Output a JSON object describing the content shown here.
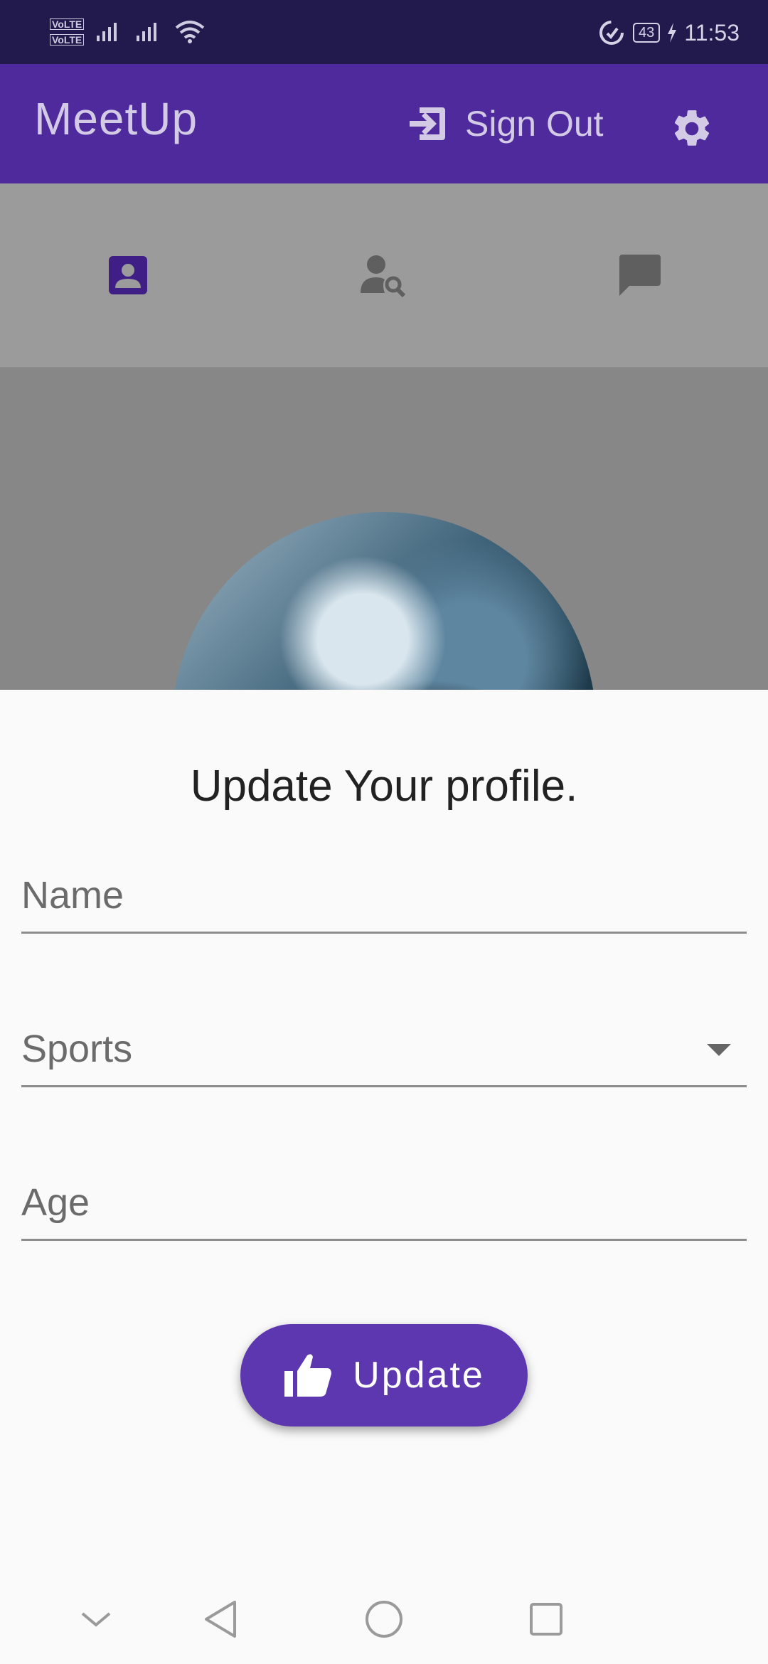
{
  "status_bar": {
    "volte_1": "VoLTE",
    "volte_2": "VoLTE",
    "battery": "43",
    "time": "11:53",
    "icons": [
      "signal-icon",
      "signal-icon",
      "wifi-icon",
      "data-saver-icon",
      "battery-icon",
      "charging-icon"
    ]
  },
  "app_bar": {
    "title": "MeetUp",
    "sign_out_label": "Sign Out",
    "sign_out_icon": "exit-icon",
    "settings_icon": "gear-icon",
    "background": "#4e2a9c"
  },
  "tabs": [
    {
      "icon": "profile-icon",
      "active": true
    },
    {
      "icon": "user-search-icon",
      "active": false
    },
    {
      "icon": "chat-icon",
      "active": false
    }
  ],
  "sheet": {
    "title": "Update Your profile.",
    "name_placeholder": "Name",
    "sports_value": "Sports",
    "age_placeholder": "Age",
    "update_label": "Update",
    "update_icon": "thumbs-up-icon",
    "accent": "#5d37b0"
  },
  "nav_bar": {
    "icons": [
      "chevron-down-icon",
      "back-icon",
      "home-icon",
      "recents-icon"
    ]
  }
}
